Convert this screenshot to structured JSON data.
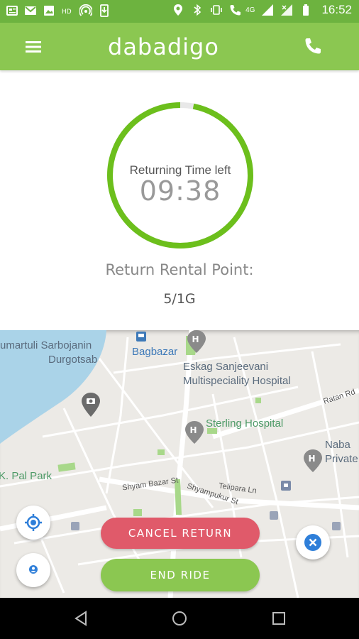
{
  "status_bar": {
    "time": "16:52",
    "network_label": "4G",
    "icons": [
      "news-icon",
      "gmail-icon",
      "image-icon",
      "hd-icon",
      "hotspot-icon",
      "download-icon",
      "location-icon",
      "bluetooth-icon",
      "vibrate-icon",
      "call-icon",
      "signal-icon",
      "signal-icon",
      "battery-icon"
    ]
  },
  "app_bar": {
    "logo_text": "dabadigo",
    "menu_icon": "hamburger-menu-icon",
    "call_icon": "phone-icon",
    "color": "#8bc751"
  },
  "timer": {
    "label": "Returning Time left",
    "value": "09:38",
    "progress_remaining": 0.97,
    "ring_color": "#6cbf1c",
    "track_color": "#e8e8e8"
  },
  "return_point": {
    "title": "Return Rental Point:",
    "value": "5/1G"
  },
  "map": {
    "labels": {
      "kumartuli": "umartuli Sarbojanin",
      "durgotsab": "Durgotsab",
      "bagbazar": "Bagbazar",
      "eskag_1": "Eskag Sanjeevani",
      "eskag_2": "Multispeciality Hospital",
      "sterling": "Sterling Hospital",
      "naba_1": "Naba",
      "naba_2": "Private",
      "kpal_park": "K. Pal Park",
      "shyam_bazar": "Shyam Bazar St",
      "shyampukur": "Shyampukur St",
      "telipara": "Telipara Ln",
      "ratan": "Ratan Rd"
    }
  },
  "actions": {
    "cancel_label": "CANCEL RETURN",
    "end_label": "END RIDE",
    "cancel_color": "#e05a6a",
    "end_color": "#8bc751"
  },
  "nav": {
    "icons": [
      "back-icon",
      "home-icon",
      "recents-icon"
    ]
  }
}
